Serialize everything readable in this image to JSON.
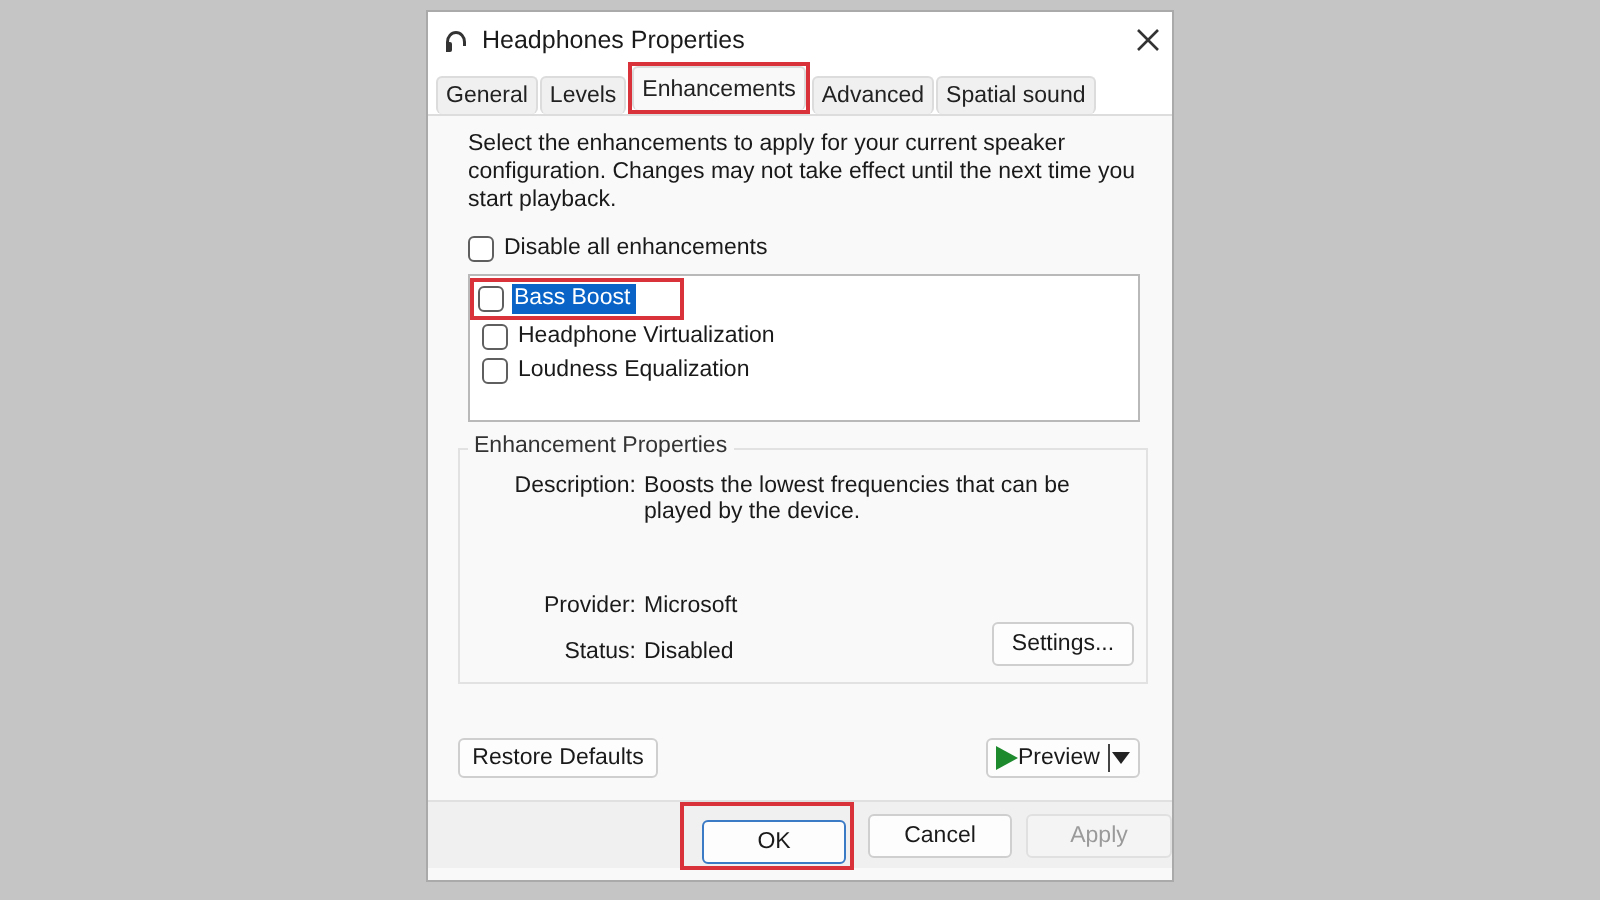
{
  "window": {
    "title": "Headphones Properties"
  },
  "tabs": [
    {
      "label": "General",
      "selected": false,
      "highlighted": false
    },
    {
      "label": "Levels",
      "selected": false,
      "highlighted": false
    },
    {
      "label": "Enhancements",
      "selected": true,
      "highlighted": true
    },
    {
      "label": "Advanced",
      "selected": false,
      "highlighted": false
    },
    {
      "label": "Spatial sound",
      "selected": false,
      "highlighted": false
    }
  ],
  "intro": "Select the enhancements to apply for your current speaker configuration. Changes may not take effect until the next time you start playback.",
  "disable_all": {
    "label": "Disable all enhancements",
    "checked": false
  },
  "enhancements": [
    {
      "label": "Bass Boost",
      "checked": false,
      "selected": true,
      "highlighted": true
    },
    {
      "label": "Headphone Virtualization",
      "checked": false,
      "selected": false,
      "highlighted": false
    },
    {
      "label": "Loudness Equalization",
      "checked": false,
      "selected": false,
      "highlighted": false
    }
  ],
  "properties": {
    "title": "Enhancement Properties",
    "description_label": "Description:",
    "description": "Boosts the lowest frequencies that can be played by the device.",
    "provider_label": "Provider:",
    "provider": "Microsoft",
    "status_label": "Status:",
    "status": "Disabled",
    "settings_button": "Settings..."
  },
  "restore_button": "Restore Defaults",
  "preview_button": "Preview",
  "footer_buttons": [
    {
      "label": "OK",
      "default": true,
      "disabled": false,
      "highlighted": true
    },
    {
      "label": "Cancel",
      "default": false,
      "disabled": false,
      "highlighted": false
    },
    {
      "label": "Apply",
      "default": false,
      "disabled": true,
      "highlighted": false
    }
  ]
}
